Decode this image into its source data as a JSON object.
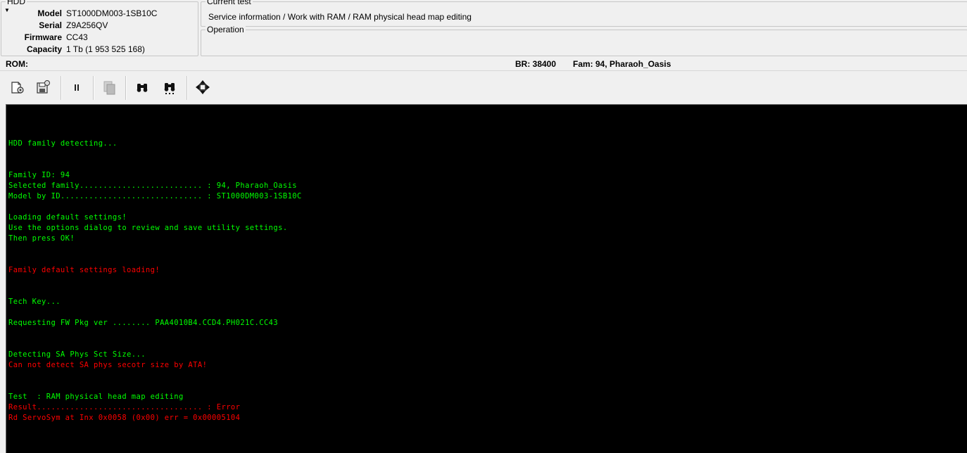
{
  "hdd": {
    "legend": "HDD",
    "fields": [
      {
        "label": "Model",
        "value": "ST1000DM003-1SB10C"
      },
      {
        "label": "Serial",
        "value": "Z9A256QV"
      },
      {
        "label": "Firmware",
        "value": "CC43"
      },
      {
        "label": "Capacity",
        "value": "1 Tb (1 953 525 168)"
      }
    ]
  },
  "current_test": {
    "legend": "Current test",
    "text": "Service information / Work with RAM / RAM physical head map editing"
  },
  "operation": {
    "legend": "Operation"
  },
  "status": {
    "rom": "ROM:",
    "br": "BR: 38400",
    "fam": "Fam: 94, Pharaoh_Oasis"
  },
  "toolbar": {
    "buttons": [
      {
        "name": "load-settings-icon"
      },
      {
        "name": "save-settings-icon"
      },
      {
        "name": "pause-icon"
      },
      {
        "name": "copy-icon"
      },
      {
        "name": "binoculars-icon"
      },
      {
        "name": "binoculars-next-icon"
      },
      {
        "name": "move-arrows-icon"
      }
    ]
  },
  "colors": {
    "console_bg": "#000000",
    "log_ok": "#00ff00",
    "log_error": "#ff0000"
  },
  "console": {
    "lines": [
      {
        "text": "HDD family detecting...",
        "color": "green"
      },
      {
        "text": "Family ID: 94",
        "color": "green"
      },
      {
        "text": "Selected family.......................... : 94, Pharaoh_Oasis",
        "color": "green"
      },
      {
        "text": "Model by ID.............................. : ST1000DM003-1SB10C",
        "color": "green"
      },
      {
        "text": "Loading default settings!",
        "color": "green"
      },
      {
        "text": "Use the options dialog to review and save utility settings.",
        "color": "green"
      },
      {
        "text": "Then press OK!",
        "color": "green"
      },
      {
        "text": "Family default settings loading!",
        "color": "red"
      },
      {
        "text": "Tech Key...",
        "color": "green"
      },
      {
        "text": "Requesting FW Pkg ver ........ PAA4010B4.CCD4.PH021C.CC43",
        "color": "green"
      },
      {
        "text": "Detecting SA Phys Sct Size...",
        "color": "green"
      },
      {
        "text": "Can not detect SA phys secotr size by ATA!",
        "color": "red"
      },
      {
        "text": "Test  : RAM physical head map editing",
        "color": "green"
      },
      {
        "text": "Result................................... : Error",
        "color": "red"
      },
      {
        "text": "Rd ServoSym at Inx 0x0058 (0x00) err = 0x00005104",
        "color": "red"
      }
    ]
  }
}
